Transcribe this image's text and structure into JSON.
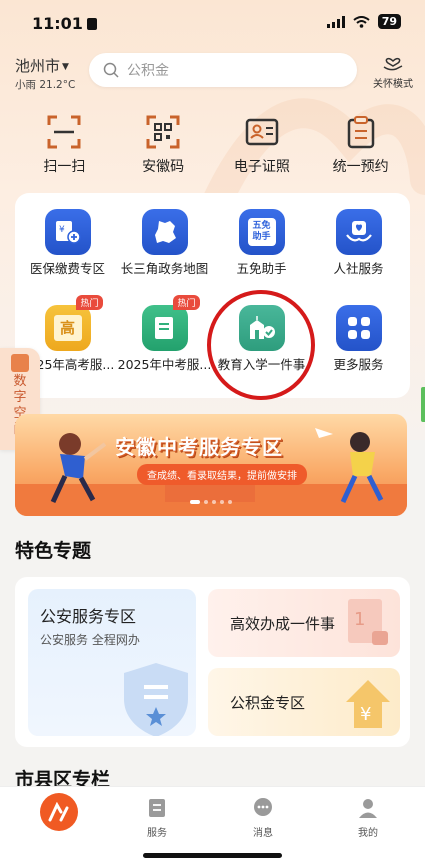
{
  "status_bar": {
    "time": "11:01",
    "battery": "79"
  },
  "header": {
    "city": "池州市",
    "weather": "小雨 21.2°C",
    "search_placeholder": "公积金",
    "care_mode": "关怀模式"
  },
  "quick_actions": [
    {
      "label": "扫一扫",
      "icon": "scan-icon"
    },
    {
      "label": "安徽码",
      "icon": "qr-code-icon"
    },
    {
      "label": "电子证照",
      "icon": "id-card-icon"
    },
    {
      "label": "统一预约",
      "icon": "clipboard-icon"
    }
  ],
  "services": [
    {
      "label": "医保缴费专区",
      "icon": "medical-payment-icon",
      "color": "#2f62db"
    },
    {
      "label": "长三角政务地图",
      "icon": "map-icon",
      "color": "#2f62db"
    },
    {
      "label": "五免助手",
      "icon": "five-free-icon",
      "color": "#2f62db",
      "icon_text": "五免 助手"
    },
    {
      "label": "人社服务",
      "icon": "social-service-icon",
      "color": "#2f62db"
    },
    {
      "label": "2025年高考服...",
      "icon": "exam-icon",
      "color": "#f2b52d",
      "badge": "热门",
      "icon_text": "高"
    },
    {
      "label": "2025年中考服...",
      "icon": "exam-doc-icon",
      "color": "#30b07b",
      "badge": "热门"
    },
    {
      "label": "教育入学一件事",
      "icon": "school-icon",
      "color": "#37a985"
    },
    {
      "label": "更多服务",
      "icon": "more-grid-icon",
      "color": "#2f62db"
    }
  ],
  "side_tab": {
    "label": "数字空间"
  },
  "banner": {
    "title": "安徽中考服务专区",
    "subtitle": "查成绩、看录取结果，提前做安排"
  },
  "featured": {
    "title": "特色专题",
    "left": {
      "title": "公安服务专区",
      "subtitle": "公安服务 全程网办"
    },
    "right_top": {
      "title": "高效办成一件事"
    },
    "right_bottom": {
      "title": "公积金专区"
    }
  },
  "next_section": {
    "title": "市县区专栏"
  },
  "tab_bar": [
    {
      "label": "",
      "icon": "home-logo-icon"
    },
    {
      "label": "服务",
      "icon": "service-icon"
    },
    {
      "label": "消息",
      "icon": "message-icon"
    },
    {
      "label": "我的",
      "icon": "profile-icon"
    }
  ],
  "colors": {
    "accent": "#f05a23",
    "highlight_ring": "#d51a1a"
  }
}
